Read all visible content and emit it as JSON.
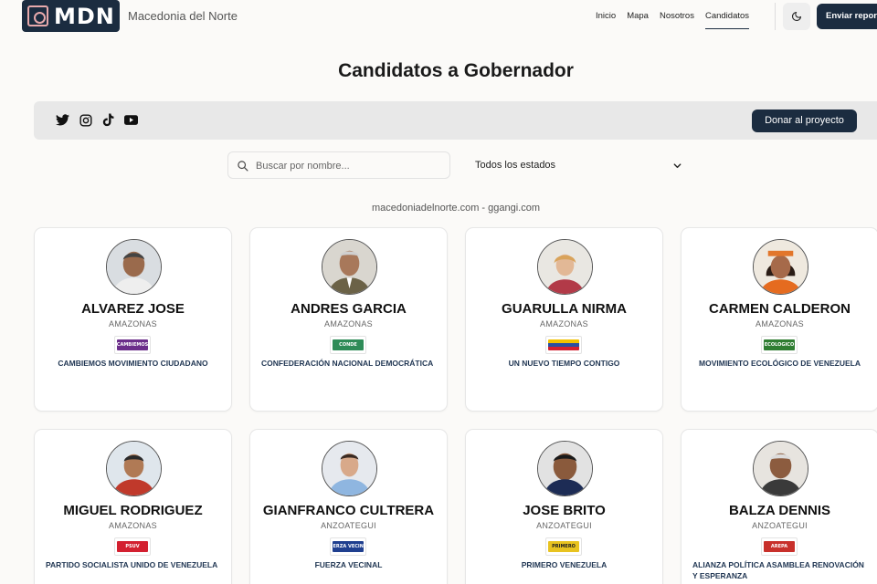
{
  "header": {
    "logo_text": "MDN",
    "site_name": "Macedonia del Norte",
    "nav": [
      "Inicio",
      "Mapa",
      "Nosotros",
      "Candidatos"
    ],
    "active_nav": "Candidatos",
    "report_button": "Enviar report"
  },
  "page": {
    "title": "Candidatos a Gobernador",
    "donate_button": "Donar al proyecto",
    "social_icons": [
      "twitter-icon",
      "instagram-icon",
      "tiktok-icon",
      "youtube-icon"
    ],
    "search_placeholder": "Buscar por nombre...",
    "state_filter": "Todos los estados",
    "domains": "macedoniadelnorte.com  -  ggangi.com"
  },
  "candidates": [
    {
      "name": "ALVAREZ JOSE",
      "state": "AMAZONAS",
      "party": "CAMBIEMOS MOVIMIENTO CIUDADANO",
      "party_logo_text": "CAMBIEMOS",
      "party_color": "#6b2d8a"
    },
    {
      "name": "ANDRES GARCIA",
      "state": "AMAZONAS",
      "party": "CONFEDERACIÓN NACIONAL DEMOCRÁTICA",
      "party_logo_text": "CONDE",
      "party_color": "#2e8b57"
    },
    {
      "name": "GUARULLA NIRMA",
      "state": "AMAZONAS",
      "party": "UN NUEVO TIEMPO CONTIGO",
      "party_logo_text": "",
      "party_color": "#f2c200"
    },
    {
      "name": "CARMEN CALDERON",
      "state": "AMAZONAS",
      "party": "MOVIMIENTO ECOLÓGICO DE VENEZUELA",
      "party_logo_text": "ECOLOGICO",
      "party_color": "#2f7d32"
    },
    {
      "name": "MIGUEL RODRIGUEZ",
      "state": "AMAZONAS",
      "party": "PARTIDO SOCIALISTA UNIDO DE VENEZUELA",
      "party_logo_text": "PSUV",
      "party_color": "#d32030"
    },
    {
      "name": "GIANFRANCO CULTRERA",
      "state": "ANZOATEGUI",
      "party": "FUERZA VECINAL",
      "party_logo_text": "FUERZA VECINAL",
      "party_color": "#1f3f8f"
    },
    {
      "name": "JOSE BRITO",
      "state": "ANZOATEGUI",
      "party": "PRIMERO VENEZUELA",
      "party_logo_text": "PRIMERO",
      "party_color": "#e8c320"
    },
    {
      "name": "BALZA DENNIS",
      "state": "ANZOATEGUI",
      "party": "ALIANZA POLÍTICA ASAMBLEA RENOVACIÓN Y ESPERANZA",
      "party_logo_text": "AREPA",
      "party_color": "#c8302b"
    }
  ]
}
